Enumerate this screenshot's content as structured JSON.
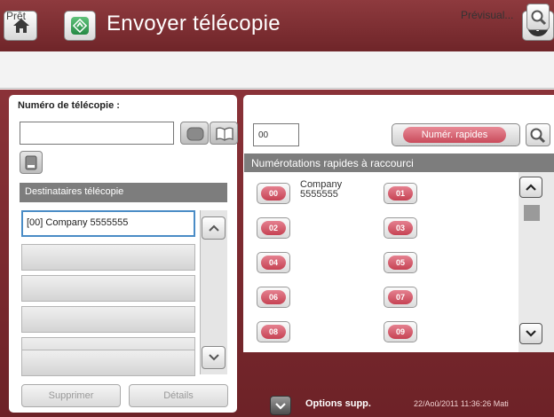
{
  "header": {
    "title": "Envoyer télécopie"
  },
  "status": {
    "text": "Prêt",
    "preview_label": "Prévisual..."
  },
  "left": {
    "fax_number_label": "Numéro de télécopie :",
    "fax_number_value": "",
    "recipients_header": "Destinataires télécopie",
    "recipients": [
      "[00] Company 5555555",
      "",
      "",
      "",
      "",
      "",
      ""
    ],
    "delete_label": "Supprimer",
    "details_label": "Détails"
  },
  "right": {
    "speed_dial_value": "00",
    "speed_dials_button": "Numér. rapides",
    "shortcut_header": "Numérotations rapides à raccourci",
    "entries": [
      {
        "code": "00",
        "name": "Company",
        "number": "5555555"
      },
      {
        "code": "01",
        "name": "",
        "number": ""
      },
      {
        "code": "02",
        "name": "",
        "number": ""
      },
      {
        "code": "03",
        "name": "",
        "number": ""
      },
      {
        "code": "04",
        "name": "",
        "number": ""
      },
      {
        "code": "05",
        "name": "",
        "number": ""
      },
      {
        "code": "06",
        "name": "",
        "number": ""
      },
      {
        "code": "07",
        "name": "",
        "number": ""
      },
      {
        "code": "08",
        "name": "",
        "number": ""
      },
      {
        "code": "09",
        "name": "",
        "number": ""
      }
    ]
  },
  "footer": {
    "options_label": "Options supp.",
    "datetime": "22/Aoû/2011 11:36:26 Mati"
  },
  "icons": {
    "home": "home-icon",
    "fax": "fax-send-icon",
    "help": "help-icon",
    "preview": "magnifier-icon",
    "backspace": "backspace-icon",
    "address_book": "address-book-icon",
    "contacts": "contacts-icon"
  },
  "colors": {
    "title_bar": "#7d2d31",
    "speed_dial_pill": "#d35a69",
    "selection_border": "#4a8cc6"
  }
}
